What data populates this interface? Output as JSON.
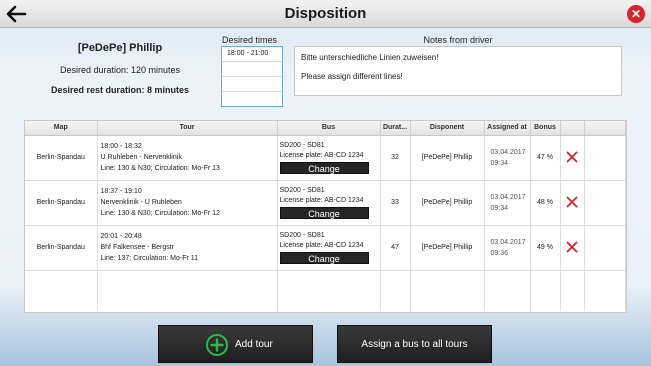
{
  "window": {
    "title": "Disposition",
    "close_glyph": "✕",
    "back_icon": "back-arrow-icon"
  },
  "driver": {
    "name": "[PeDePe] Phillip",
    "desired_duration": "Desired duration: 120 minutes",
    "desired_rest": "Desired rest duration: 8 minutes"
  },
  "desired_times": {
    "label": "Desired times",
    "rows": [
      "18:00 - 21:00",
      "",
      "",
      ""
    ]
  },
  "notes": {
    "label": "Notes from driver",
    "lines": [
      "Bitte unterschiedliche Linien zuweisen!",
      "Please assign different lines!"
    ]
  },
  "table": {
    "headers": [
      "Map",
      "Tour",
      "Bus",
      "Durat...",
      "Disponent",
      "Assigned at",
      "Bonus",
      ""
    ],
    "change_label": "Change",
    "rows": [
      {
        "map": "Berlin-Spandau",
        "tour_time": "18:00 - 18:32",
        "tour_route": "U Ruhleben - Nervenklinik",
        "tour_line": "Line: 130 & N30; Circulation: Mo-Fr 13",
        "bus_name": "SD200 - SD81",
        "bus_plate": "License plate: AB-CD 1234",
        "duration": "32",
        "disponent": "[PeDePe] Phillip",
        "assigned_date": "03.04.2017",
        "assigned_time": "09:34",
        "bonus": "47 %"
      },
      {
        "map": "Berlin-Spandau",
        "tour_time": "18:37 - 19:10",
        "tour_route": "Nervenklinik - U Ruhleben",
        "tour_line": "Line: 130 & N30; Circulation: Mo-Fr 12",
        "bus_name": "SD200 - SD81",
        "bus_plate": "License plate: AB-CD 1234",
        "duration": "33",
        "disponent": "[PeDePe] Phillip",
        "assigned_date": "03.04.2017",
        "assigned_time": "09:34",
        "bonus": "48 %"
      },
      {
        "map": "Berlin-Spandau",
        "tour_time": "20:01 - 20:48",
        "tour_route": "Bhf Falkensee - Bergstr",
        "tour_line": "Line: 137; Circulation: Mo-Fr 11",
        "bus_name": "SD200 - SD81",
        "bus_plate": "License plate: AB-CD 1234",
        "duration": "47",
        "disponent": "[PeDePe] Phillip",
        "assigned_date": "03.04.2017",
        "assigned_time": "09:36",
        "bonus": "49 %"
      }
    ]
  },
  "buttons": {
    "add_tour": "Add tour",
    "assign_all": "Assign a bus to all tours"
  },
  "colors": {
    "close": "#d9232a",
    "delete": "#d9232a",
    "add_icon": "#2fb84a",
    "selection_border": "#6fa8dc"
  }
}
